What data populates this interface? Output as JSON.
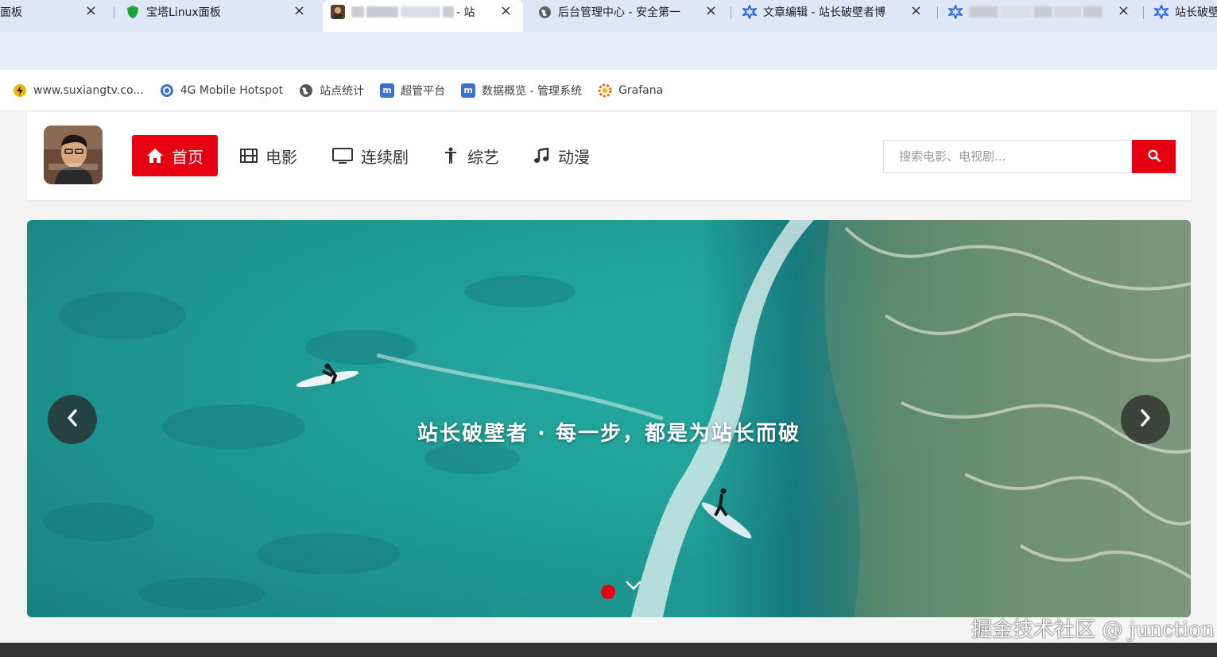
{
  "browser": {
    "tabs": [
      {
        "title": "面板",
        "icon": "generic-icon"
      },
      {
        "title": "宝塔Linux面板",
        "icon": "bt-shield-icon"
      },
      {
        "title": "- 站",
        "icon": "site-avatar-icon",
        "active": true
      },
      {
        "title": "后台管理中心 - 安全第一",
        "icon": "globe-icon"
      },
      {
        "title": "文章编辑 - 站长破壁者博",
        "icon": "puzzle-icon"
      },
      {
        "title": "",
        "icon": "puzzle-icon"
      },
      {
        "title": "站长破壁",
        "icon": "puzzle-icon"
      }
    ],
    "bookmarks": [
      {
        "label": "www.suxiangtv.co...",
        "icon": "bolt-icon",
        "color": "#f5b400"
      },
      {
        "label": "4G Mobile Hotspot",
        "icon": "hotspot-icon",
        "color": "#3b6fd4"
      },
      {
        "label": "站点统计",
        "icon": "globe-icon",
        "color": "#555555"
      },
      {
        "label": "超管平台",
        "icon": "m-square-icon",
        "color": "#3b6fd4"
      },
      {
        "label": "数据概览 - 管理系统",
        "icon": "m-square-icon",
        "color": "#3b6fd4"
      },
      {
        "label": "Grafana",
        "icon": "grafana-icon",
        "color": "#f46800"
      }
    ]
  },
  "site": {
    "nav": [
      {
        "label": "首页",
        "icon": "home-icon",
        "active": true
      },
      {
        "label": "电影",
        "icon": "film-icon"
      },
      {
        "label": "连续剧",
        "icon": "tv-icon"
      },
      {
        "label": "综艺",
        "icon": "person-icon"
      },
      {
        "label": "动漫",
        "icon": "music-icon"
      }
    ],
    "search": {
      "placeholder": "搜索电影、电视剧..."
    },
    "banner": {
      "caption": "站长破壁者 · 每一步，都是为站长而破",
      "slide_count": 1,
      "active_slide": 1
    },
    "accent_color": "#e60012"
  },
  "watermark": "掘金技术社区 @ junction"
}
